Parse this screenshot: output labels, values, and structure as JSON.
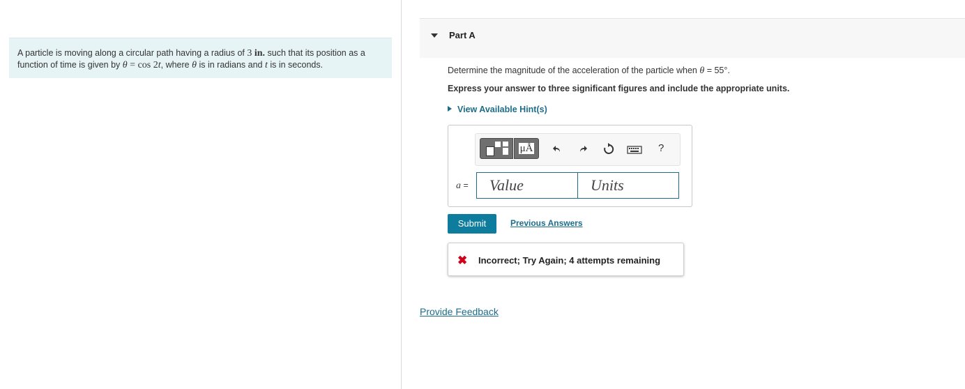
{
  "problem": {
    "text_1": "A particle is moving along a circular path having a radius of ",
    "radius_value": "3",
    "radius_unit": "in.",
    "text_2": " such that its position as a function of time is given by ",
    "theta_symbol": "θ",
    "equals_cos": " = cos ",
    "two": "2",
    "t_symbol": "t",
    "text_3": ", where ",
    "text_4": " is in radians and ",
    "text_5": " is in seconds."
  },
  "part": {
    "title": "Part A"
  },
  "question": {
    "text_1": "Determine the magnitude of the acceleration of the particle when ",
    "theta_symbol": "θ",
    "text_2": " = 55°.",
    "instruction": "Express your answer to three significant figures and include the appropriate units."
  },
  "hint": {
    "label": "View Available Hint(s)"
  },
  "toolbar": {
    "units_label": "μÅ",
    "help_label": "?"
  },
  "answer": {
    "variable": "a",
    "equals": " =",
    "value_placeholder": "Value",
    "units_placeholder": "Units"
  },
  "actions": {
    "submit_label": "Submit",
    "previous_answers_label": "Previous Answers"
  },
  "feedback": {
    "icon": "✖",
    "message": "Incorrect; Try Again; 4 attempts remaining"
  },
  "footer": {
    "provide_feedback_label": "Provide Feedback"
  },
  "colors": {
    "accent": "#0e7c9c",
    "link": "#1d6d8a",
    "error": "#d0021b",
    "problem_bg": "#e7f4f6"
  }
}
